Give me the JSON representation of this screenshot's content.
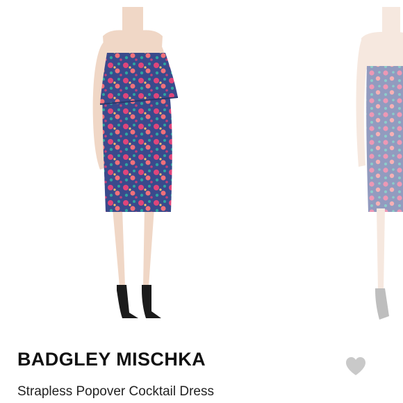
{
  "listing": {
    "brand": "BADGLEY MISCHKA",
    "title": "Strapless Popover Cocktail Dress"
  },
  "colors": {
    "heart": "#c9c9c9",
    "dress_base": "#3a4a8c",
    "dress_accent_pink": "#e0457a",
    "dress_accent_coral": "#f2707a",
    "dress_accent_teal": "#2fa5a0",
    "skin": "#f0d7c6"
  },
  "icons": {
    "like": "heart-icon"
  }
}
